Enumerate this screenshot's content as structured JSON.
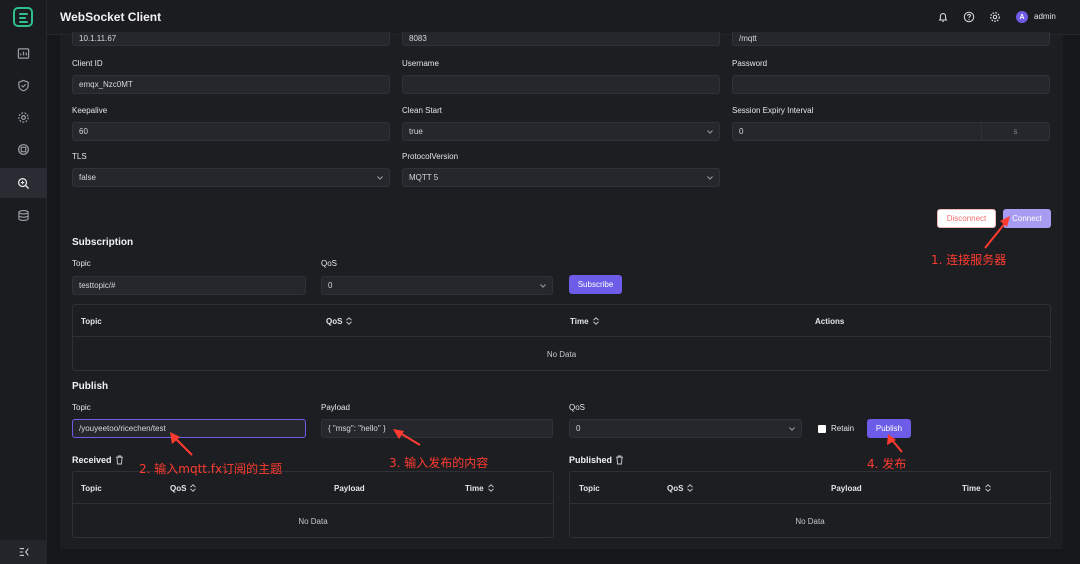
{
  "app": {
    "title": "WebSocket Client",
    "user": "admin",
    "avatar_letter": "A"
  },
  "connection": {
    "host_value": "10.1.11.67",
    "port_value": "8083",
    "path_value": "/mqtt",
    "client_id_label": "Client ID",
    "client_id_value": "emqx_Nzc0MT",
    "username_label": "Username",
    "username_value": "",
    "password_label": "Password",
    "password_value": "",
    "keepalive_label": "Keepalive",
    "keepalive_value": "60",
    "clean_start_label": "Clean Start",
    "clean_start_value": "true",
    "session_expiry_label": "Session Expiry Interval",
    "session_expiry_value": "0",
    "session_expiry_unit": "s",
    "tls_label": "TLS",
    "tls_value": "false",
    "protocol_label": "ProtocolVersion",
    "protocol_value": "MQTT 5",
    "disconnect_label": "Disconnect",
    "connect_label": "Connect"
  },
  "subscription": {
    "title": "Subscription",
    "topic_label": "Topic",
    "topic_value": "testtopic/#",
    "qos_label": "QoS",
    "qos_value": "0",
    "subscribe_label": "Subscribe",
    "columns": [
      "Topic",
      "QoS",
      "Time",
      "Actions"
    ],
    "empty_text": "No Data"
  },
  "publish": {
    "title": "Publish",
    "topic_label": "Topic",
    "topic_value": "/youyeetoo/ricechen/test",
    "payload_label": "Payload",
    "payload_value": "{ \"msg\": \"hello\" }",
    "qos_label": "QoS",
    "qos_value": "0",
    "retain_label": "Retain",
    "publish_label": "Publish"
  },
  "received": {
    "title": "Received",
    "columns": [
      "Topic",
      "QoS",
      "Payload",
      "Time"
    ],
    "empty_text": "No Data"
  },
  "published": {
    "title": "Published",
    "columns": [
      "Topic",
      "QoS",
      "Payload",
      "Time"
    ],
    "empty_text": "No Data"
  },
  "annotations": {
    "step1": "1. 连接服务器",
    "step2": "2. 输入mqtt.fx订阅的主题",
    "step3": "3. 输入发布的内容",
    "step4": "4. 发布"
  },
  "colors": {
    "accent": "#6c5ce7",
    "annotation": "#ff3b30",
    "brand": "#2fbf8a"
  }
}
